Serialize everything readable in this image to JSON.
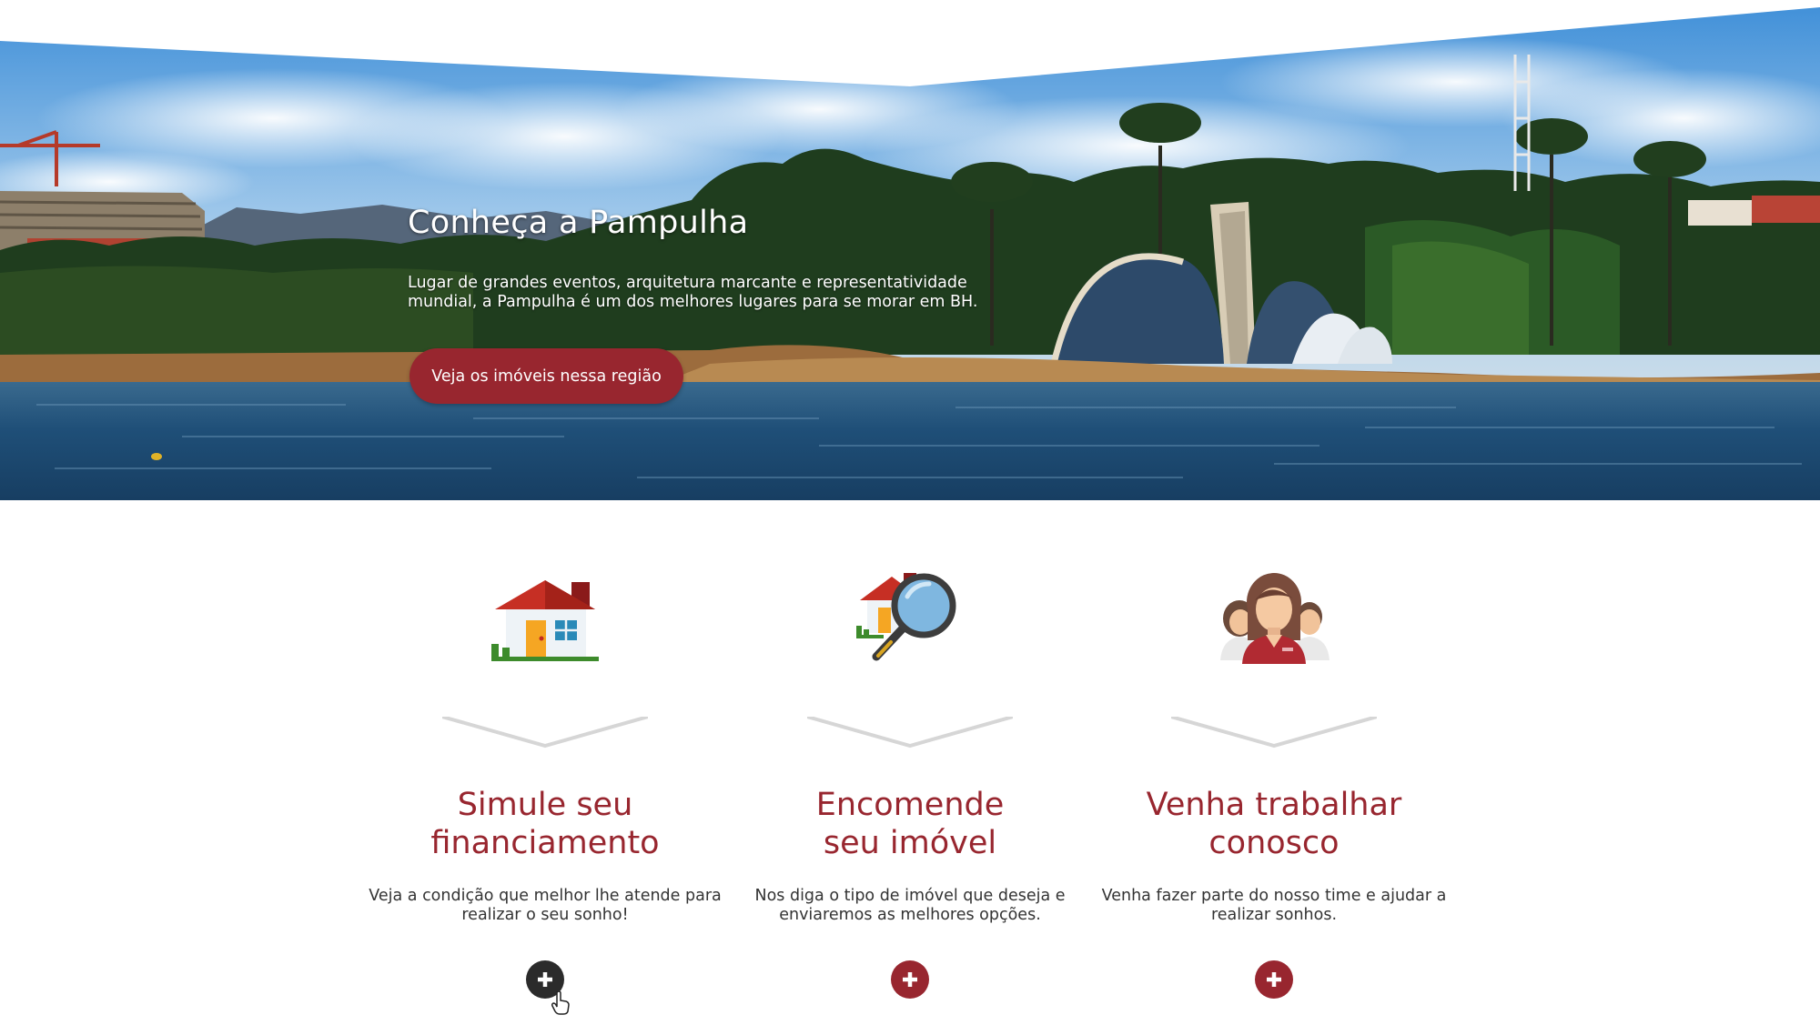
{
  "hero": {
    "title": "Conheça a Pampulha",
    "description": "Lugar de grandes eventos, arquitetura marcante e representatividade mundial, a Pampulha é um dos melhores lugares para se morar em BH.",
    "button_label": "Veja os imóveis nessa região"
  },
  "services": [
    {
      "icon": "house-icon",
      "title_line1": "Simule seu",
      "title_line2": "financiamento",
      "description": "Veja a condição que melhor lhe atende para realizar o seu sonho!",
      "button_icon": "plus-icon"
    },
    {
      "icon": "house-search-icon",
      "title_line1": "Encomende",
      "title_line2": "seu imóvel",
      "description": "Nos diga o tipo de imóvel que deseja e enviaremos as melhores opções.",
      "button_icon": "plus-icon"
    },
    {
      "icon": "team-icon",
      "title_line1": "Venha trabalhar",
      "title_line2": "conosco",
      "description": "Venha fazer parte do nosso time e ajudar a realizar sonhos.",
      "button_icon": "plus-icon"
    }
  ],
  "colors": {
    "brand": "#98262f",
    "hovered_button": "#2b2b2b",
    "text": "#333333"
  }
}
